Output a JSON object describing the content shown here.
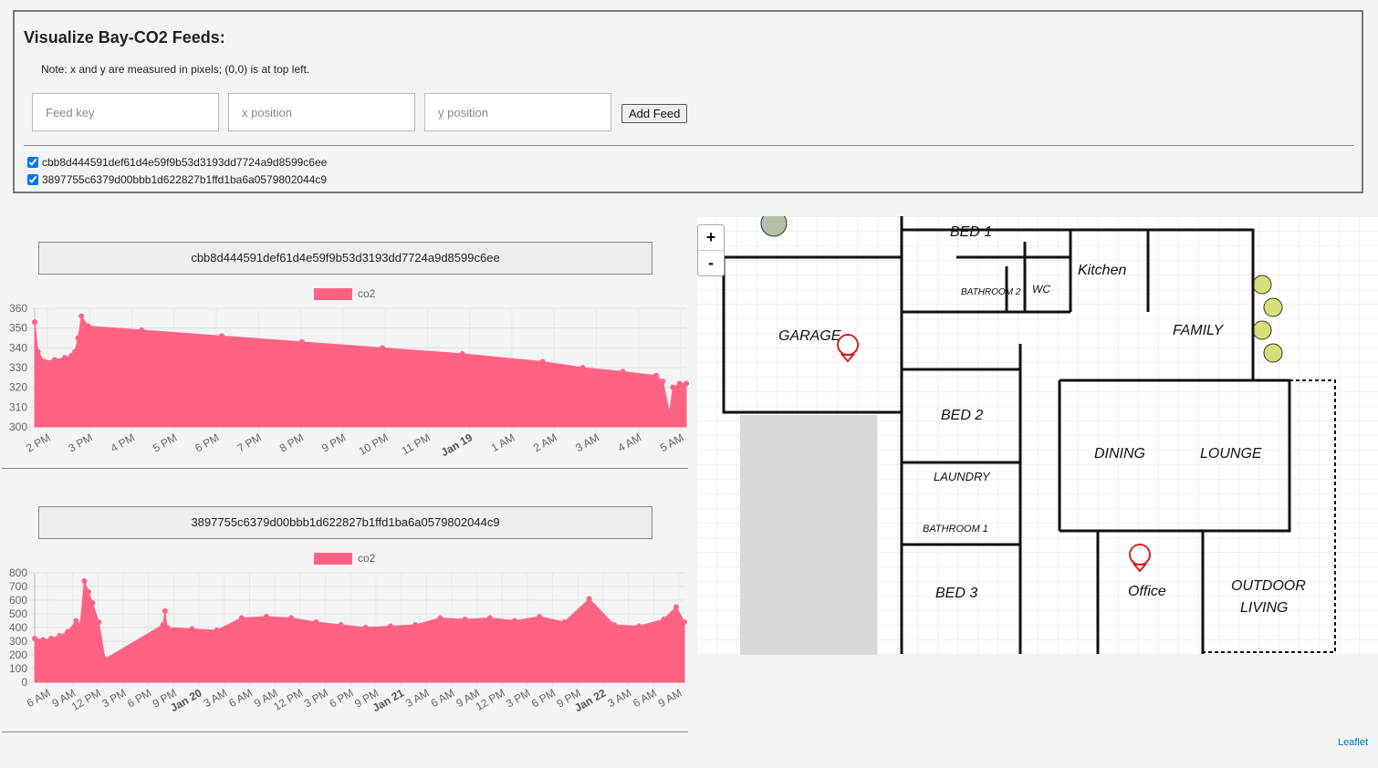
{
  "form": {
    "title": "Visualize Bay-CO2 Feeds:",
    "note": "Note: x and y are measured in pixels; (0,0) is at top left.",
    "feed_key_placeholder": "Feed key",
    "x_placeholder": "x position",
    "y_placeholder": "y position",
    "add_button": "Add Feed"
  },
  "feeds": [
    {
      "key": "cbb8d444591def61d4e59f9b53d3193dd7724a9d8599c6ee",
      "checked": true
    },
    {
      "key": "3897755c6379d00bbb1d622827b1ffd1ba6a0579802044c9",
      "checked": true
    }
  ],
  "charts": [
    {
      "header": "cbb8d444591def61d4e59f9b53d3193dd7724a9d8599c6ee",
      "legend": "co2"
    },
    {
      "header": "3897755c6379d00bbb1d622827b1ffd1ba6a0579802044c9",
      "legend": "co2"
    }
  ],
  "chart_data": [
    {
      "type": "area",
      "color": "#ff6384",
      "series": [
        {
          "name": "co2",
          "x": [
            "2017-01-18T13:20",
            "2017-01-18T13:25",
            "2017-01-18T13:35",
            "2017-01-18T13:50",
            "2017-01-18T14:05",
            "2017-01-18T14:15",
            "2017-01-18T14:20",
            "2017-01-18T14:25",
            "2017-01-18T14:30",
            "2017-01-18T14:40",
            "2017-01-18T16:00",
            "2017-01-18T18:00",
            "2017-01-18T20:00",
            "2017-01-18T22:00",
            "2017-01-19T00:00",
            "2017-01-19T02:00",
            "2017-01-19T03:00",
            "2017-01-19T04:00",
            "2017-01-19T04:50",
            "2017-01-19T05:00",
            "2017-01-19T05:10",
            "2017-01-19T05:15",
            "2017-01-19T05:25",
            "2017-01-19T05:35"
          ],
          "values": [
            353,
            338,
            333,
            334,
            335,
            336,
            338,
            345,
            356,
            351,
            349,
            346,
            343,
            340,
            337,
            333,
            330,
            328,
            326,
            323,
            307,
            320,
            322,
            322
          ]
        }
      ],
      "xticks": [
        "2 PM",
        "3 PM",
        "4 PM",
        "5 PM",
        "6 PM",
        "7 PM",
        "8 PM",
        "9 PM",
        "10 PM",
        "11 PM",
        "Jan 19",
        "1 AM",
        "2 AM",
        "3 AM",
        "4 AM",
        "5 AM"
      ],
      "ylim": [
        300,
        360
      ],
      "yticks": [
        300,
        310,
        320,
        330,
        340,
        350,
        360
      ]
    },
    {
      "type": "area",
      "color": "#ff6384",
      "series": [
        {
          "name": "co2",
          "x": [
            "2017-01-19T05:00",
            "2017-01-19T06:00",
            "2017-01-19T07:00",
            "2017-01-19T08:00",
            "2017-01-19T09:00",
            "2017-01-19T10:00",
            "2017-01-19T10:30",
            "2017-01-19T11:00",
            "2017-01-19T11:30",
            "2017-01-19T12:00",
            "2017-01-19T12:45",
            "2017-01-19T13:30",
            "2017-01-19T20:30",
            "2017-01-19T20:45",
            "2017-01-19T21:00",
            "2017-01-20T00:00",
            "2017-01-20T03:00",
            "2017-01-20T06:00",
            "2017-01-20T09:00",
            "2017-01-20T12:00",
            "2017-01-20T15:00",
            "2017-01-20T18:00",
            "2017-01-20T21:00",
            "2017-01-21T00:00",
            "2017-01-21T03:00",
            "2017-01-21T06:00",
            "2017-01-21T09:00",
            "2017-01-21T12:00",
            "2017-01-21T15:00",
            "2017-01-21T18:00",
            "2017-01-21T21:00",
            "2017-01-22T00:00",
            "2017-01-22T03:00",
            "2017-01-22T06:00",
            "2017-01-22T09:00",
            "2017-01-22T10:30",
            "2017-01-22T11:30"
          ],
          "values": [
            320,
            310,
            320,
            340,
            370,
            450,
            420,
            740,
            660,
            580,
            440,
            170,
            420,
            520,
            400,
            390,
            380,
            470,
            480,
            470,
            440,
            420,
            400,
            410,
            420,
            470,
            460,
            470,
            450,
            480,
            440,
            610,
            420,
            410,
            460,
            550,
            440
          ]
        }
      ],
      "xticks": [
        "6 AM",
        "9 AM",
        "12 PM",
        "3 PM",
        "6 PM",
        "9 PM",
        "Jan 20",
        "3 AM",
        "6 AM",
        "9 AM",
        "12 PM",
        "3 PM",
        "6 PM",
        "9 PM",
        "Jan 21",
        "3 AM",
        "6 AM",
        "9 AM",
        "12 PM",
        "3 PM",
        "6 PM",
        "9 PM",
        "Jan 22",
        "3 AM",
        "6 AM",
        "9 AM"
      ],
      "ylim": [
        0,
        800
      ],
      "yticks": [
        0,
        100,
        200,
        300,
        400,
        500,
        600,
        700,
        800
      ]
    }
  ],
  "map": {
    "rooms": [
      "BED 1",
      "Kitchen",
      "BATHROOM 2",
      "WC",
      "GARAGE",
      "FAMILY",
      "BED 2",
      "DINING",
      "LOUNGE",
      "LAUNDRY",
      "BATHROOM 1",
      "BED 3",
      "Office",
      "OUTDOOR",
      "LIVING"
    ],
    "zoom_in": "+",
    "zoom_out": "-",
    "attribution": "Leaflet",
    "marker_color": "#e31a1c"
  }
}
